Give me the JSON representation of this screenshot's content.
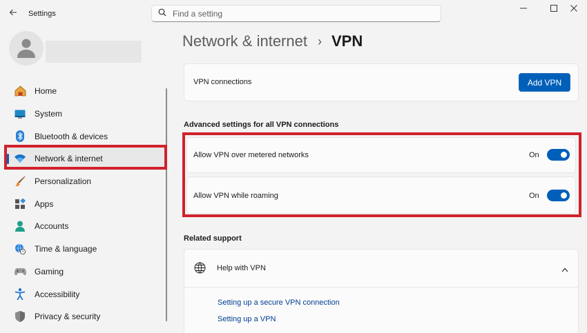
{
  "window": {
    "app_title": "Settings",
    "back_icon": "back-arrow-icon",
    "controls": [
      "minimize-icon",
      "maximize-icon",
      "close-icon"
    ]
  },
  "search": {
    "placeholder": "Find a setting",
    "value": ""
  },
  "sidebar": {
    "items": [
      {
        "label": "Home",
        "icon": "home-icon",
        "active": false
      },
      {
        "label": "System",
        "icon": "system-icon",
        "active": false
      },
      {
        "label": "Bluetooth & devices",
        "icon": "bluetooth-icon",
        "active": false
      },
      {
        "label": "Network & internet",
        "icon": "wifi-icon",
        "active": true
      },
      {
        "label": "Personalization",
        "icon": "brush-icon",
        "active": false
      },
      {
        "label": "Apps",
        "icon": "apps-icon",
        "active": false
      },
      {
        "label": "Accounts",
        "icon": "person-icon",
        "active": false
      },
      {
        "label": "Time & language",
        "icon": "globe-clock-icon",
        "active": false
      },
      {
        "label": "Gaming",
        "icon": "gamepad-icon",
        "active": false
      },
      {
        "label": "Accessibility",
        "icon": "accessibility-icon",
        "active": false
      },
      {
        "label": "Privacy & security",
        "icon": "shield-icon",
        "active": false
      }
    ]
  },
  "breadcrumb": {
    "parent": "Network & internet",
    "separator": "›",
    "current": "VPN"
  },
  "vpn_connections": {
    "label": "VPN connections",
    "add_button": "Add VPN"
  },
  "advanced": {
    "title": "Advanced settings for all VPN connections",
    "metered": {
      "label": "Allow VPN over metered networks",
      "state": "On",
      "on": true
    },
    "roaming": {
      "label": "Allow VPN while roaming",
      "state": "On",
      "on": true
    }
  },
  "related": {
    "title": "Related support",
    "help_label": "Help with VPN",
    "help_icon": "globe-icon",
    "links": [
      "Setting up a secure VPN connection",
      "Setting up a VPN"
    ]
  },
  "colors": {
    "accent": "#005fb8",
    "highlight": "#d1212b",
    "background": "#f3f3f3"
  }
}
